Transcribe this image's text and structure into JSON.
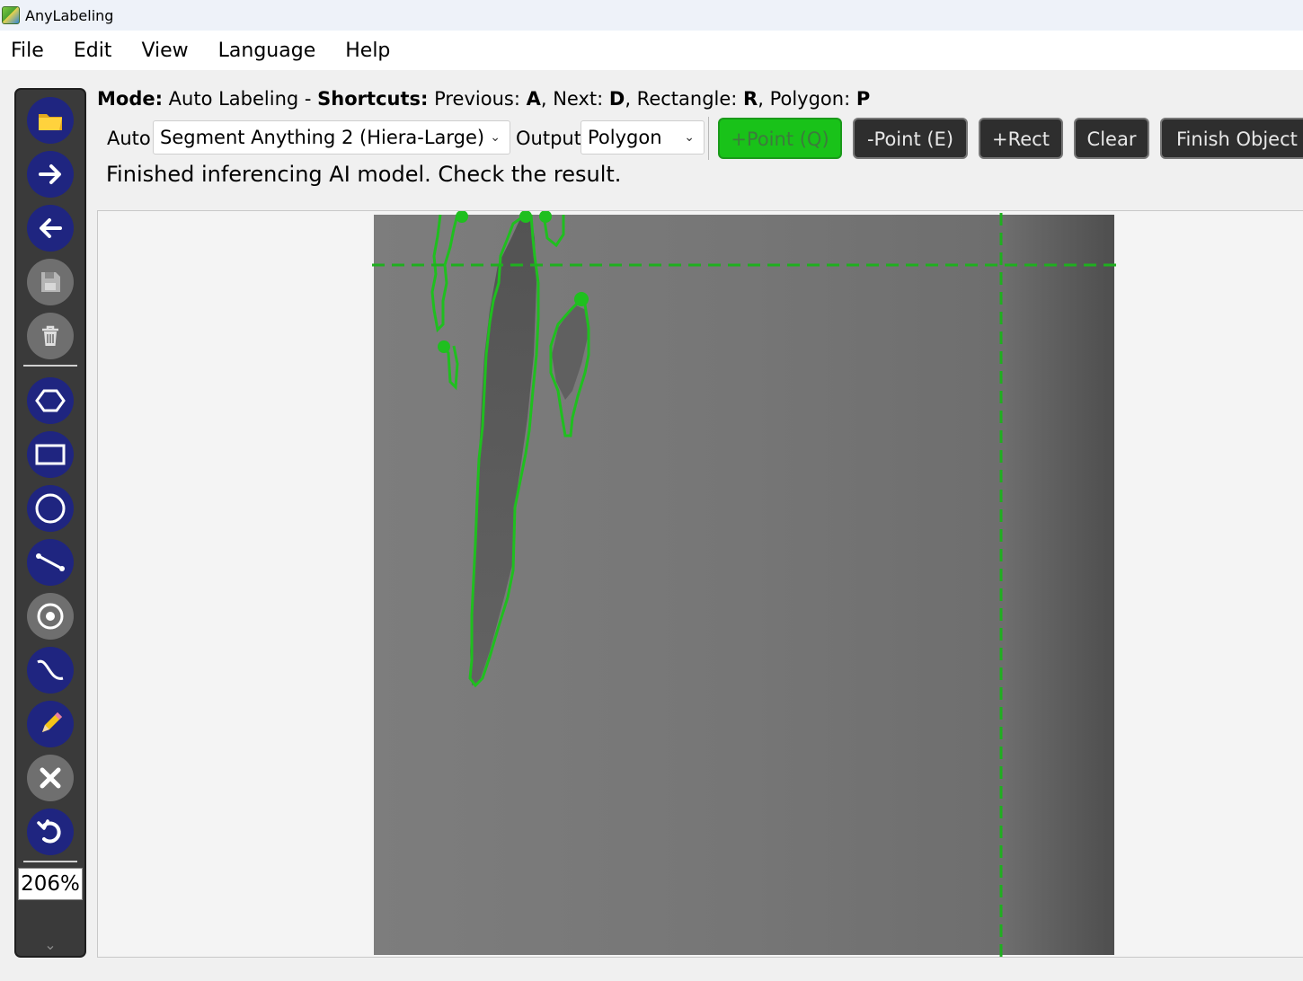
{
  "window": {
    "title": "AnyLabeling"
  },
  "menu": [
    "File",
    "Edit",
    "View",
    "Language",
    "Help"
  ],
  "mode_bar": {
    "mode_label": "Mode:",
    "mode_value": " Auto Labeling - ",
    "shortcuts_label": "Shortcuts:",
    "prev_text": " Previous: ",
    "prev_key": "A",
    "next_text": ", Next: ",
    "next_key": "D",
    "rect_text": ", Rectangle: ",
    "rect_key": "R",
    "poly_text": ", Polygon: ",
    "poly_key": "P"
  },
  "auto_controls": {
    "auto_label": "Auto",
    "model_value": "Segment Anything 2 (Hiera-Large)",
    "output_label": "Output",
    "output_value": "Polygon",
    "buttons": {
      "add_point": "+Point (Q)",
      "remove_point": "-Point (E)",
      "add_rect": "+Rect",
      "clear": "Clear",
      "finish": "Finish Object ("
    }
  },
  "status_message": "Finished inferencing AI model. Check the result.",
  "toolbar": {
    "zoom": "206%",
    "tools": [
      "open-folder",
      "next-image",
      "previous-image",
      "save",
      "delete",
      "create-polygon",
      "create-rectangle",
      "create-circle",
      "create-line",
      "create-point",
      "create-linestrip",
      "edit-brush",
      "close",
      "undo"
    ]
  },
  "colors": {
    "accent_green": "#19c219",
    "annotation_green": "#1fbf1f",
    "tool_blue": "#1f2580",
    "toolbar_bg": "#3a3a3a"
  }
}
